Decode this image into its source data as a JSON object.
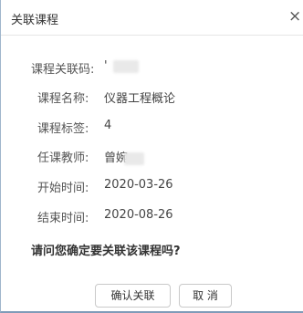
{
  "dialog": {
    "title": "关联课程",
    "close_symbol": "×"
  },
  "fields": [
    {
      "label": "课程关联码:",
      "value": "'"
    },
    {
      "label": "课程名称:",
      "value": "仪器工程概论"
    },
    {
      "label": "课程标签:",
      "value": "4"
    },
    {
      "label": "任课教师:",
      "value": "曾婉"
    },
    {
      "label": "开始时间:",
      "value": "2020-03-26"
    },
    {
      "label": "结束时间:",
      "value": "2020-08-26"
    }
  ],
  "question": "请问您确定要关联该课程吗?",
  "buttons": {
    "confirm": "确认关联",
    "cancel": "取 消"
  }
}
